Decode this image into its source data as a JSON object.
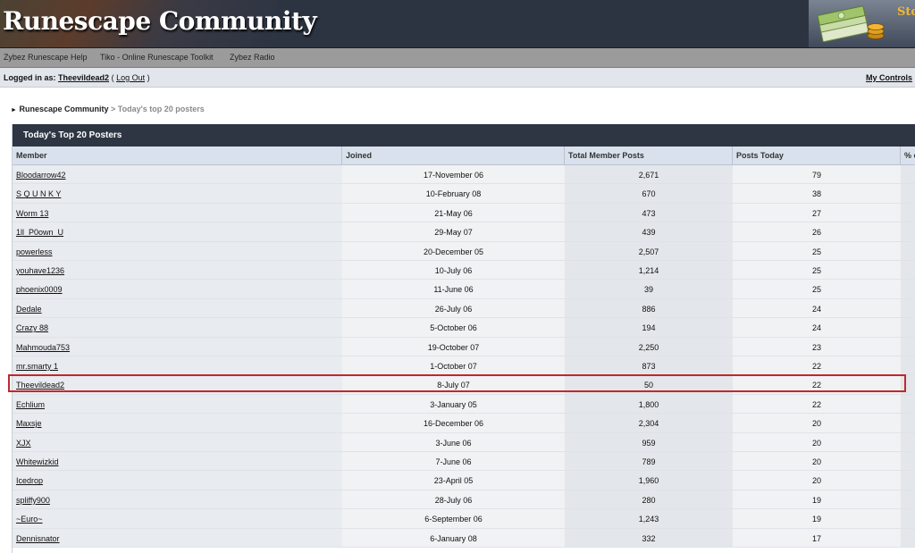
{
  "header": {
    "title": "Runescape Community",
    "store_text": "Sto",
    "money_icon": "money-stack-icon"
  },
  "nav": {
    "items": [
      {
        "label": "Zybez Runescape Help"
      },
      {
        "label": "Tiko - Online Runescape Toolkit"
      },
      {
        "label": "Zybez Radio"
      }
    ]
  },
  "user": {
    "logged_in_label": "Logged in as:",
    "username": "Theevildead2",
    "logout_label": "Log Out",
    "my_controls_label": "My Controls"
  },
  "breadcrumb": {
    "arrow": "►",
    "community": "Runescape Community",
    "separator": ">",
    "current": "Today's top 20 posters"
  },
  "panel": {
    "title": "Today's Top 20 Posters",
    "columns": [
      "Member",
      "Joined",
      "Total Member Posts",
      "Posts Today",
      "% c"
    ]
  },
  "rows": [
    {
      "member": "Bloodarrow42",
      "joined": "17-November 06",
      "total": "2,671",
      "today": "79"
    },
    {
      "member": "S Q U N K Y",
      "joined": "10-February 08",
      "total": "670",
      "today": "38"
    },
    {
      "member": "Worm 13",
      "joined": "21-May 06",
      "total": "473",
      "today": "27"
    },
    {
      "member": "1ll_P0own_U",
      "joined": "29-May 07",
      "total": "439",
      "today": "26"
    },
    {
      "member": "powerless",
      "joined": "20-December 05",
      "total": "2,507",
      "today": "25"
    },
    {
      "member": "youhave1236",
      "joined": "10-July 06",
      "total": "1,214",
      "today": "25"
    },
    {
      "member": "phoenix0009",
      "joined": "11-June 06",
      "total": "39",
      "today": "25"
    },
    {
      "member": "Dedale",
      "joined": "26-July 06",
      "total": "886",
      "today": "24"
    },
    {
      "member": "Crazy 88",
      "joined": "5-October 06",
      "total": "194",
      "today": "24"
    },
    {
      "member": "Mahmouda753",
      "joined": "19-October 07",
      "total": "2,250",
      "today": "23"
    },
    {
      "member": "mr.smarty 1",
      "joined": "1-October 07",
      "total": "873",
      "today": "22"
    },
    {
      "member": "Theevildead2",
      "joined": "8-July 07",
      "total": "50",
      "today": "22"
    },
    {
      "member": "Echlium",
      "joined": "3-January 05",
      "total": "1,800",
      "today": "22"
    },
    {
      "member": "Maxsje",
      "joined": "16-December 06",
      "total": "2,304",
      "today": "20"
    },
    {
      "member": "XJX",
      "joined": "3-June 06",
      "total": "959",
      "today": "20"
    },
    {
      "member": "Whitewizkid",
      "joined": "7-June 06",
      "total": "789",
      "today": "20"
    },
    {
      "member": "Icedrop",
      "joined": "23-April 05",
      "total": "1,960",
      "today": "20"
    },
    {
      "member": "spliffy900",
      "joined": "28-July 06",
      "total": "280",
      "today": "19"
    },
    {
      "member": "~Euro~",
      "joined": "6-September 06",
      "total": "1,243",
      "today": "19"
    },
    {
      "member": "Dennisnator",
      "joined": "6-January 08",
      "total": "332",
      "today": "17"
    }
  ],
  "highlight_row": 11,
  "colors": {
    "header_bg": "#2c3442",
    "nav_bg": "#9b9b9b",
    "panel_title_bg": "#2e3644",
    "highlight_border": "#c0282d"
  }
}
